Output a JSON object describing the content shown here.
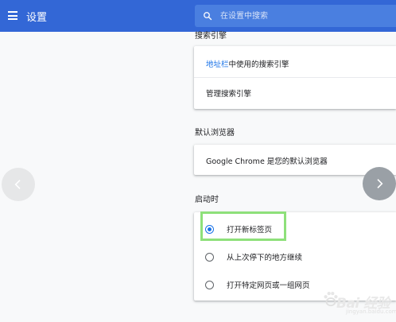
{
  "header": {
    "title": "设置",
    "search_placeholder": "在设置中搜索",
    "color": "#3367d6"
  },
  "search_engine": {
    "title": "搜索引擎",
    "address_bar_link": "地址栏",
    "address_bar_rest": "中使用的搜索引擎",
    "manage_label": "管理搜索引擎"
  },
  "default_browser": {
    "title": "默认浏览器",
    "status": "Google Chrome 是您的默认浏览器"
  },
  "on_startup": {
    "title": "启动时",
    "options": [
      {
        "label": "打开新标签页",
        "checked": true
      },
      {
        "label": "从上次停下的地方继续",
        "checked": false
      },
      {
        "label": "打开特定网页或一组网页",
        "checked": false
      }
    ]
  },
  "watermark": {
    "brand": "Bai 经验",
    "url": "jingyan.baidu.com"
  },
  "icons": [
    "menu-icon",
    "search-icon",
    "chevron-left-icon",
    "chevron-right-icon",
    "baidu-paw-icon"
  ]
}
